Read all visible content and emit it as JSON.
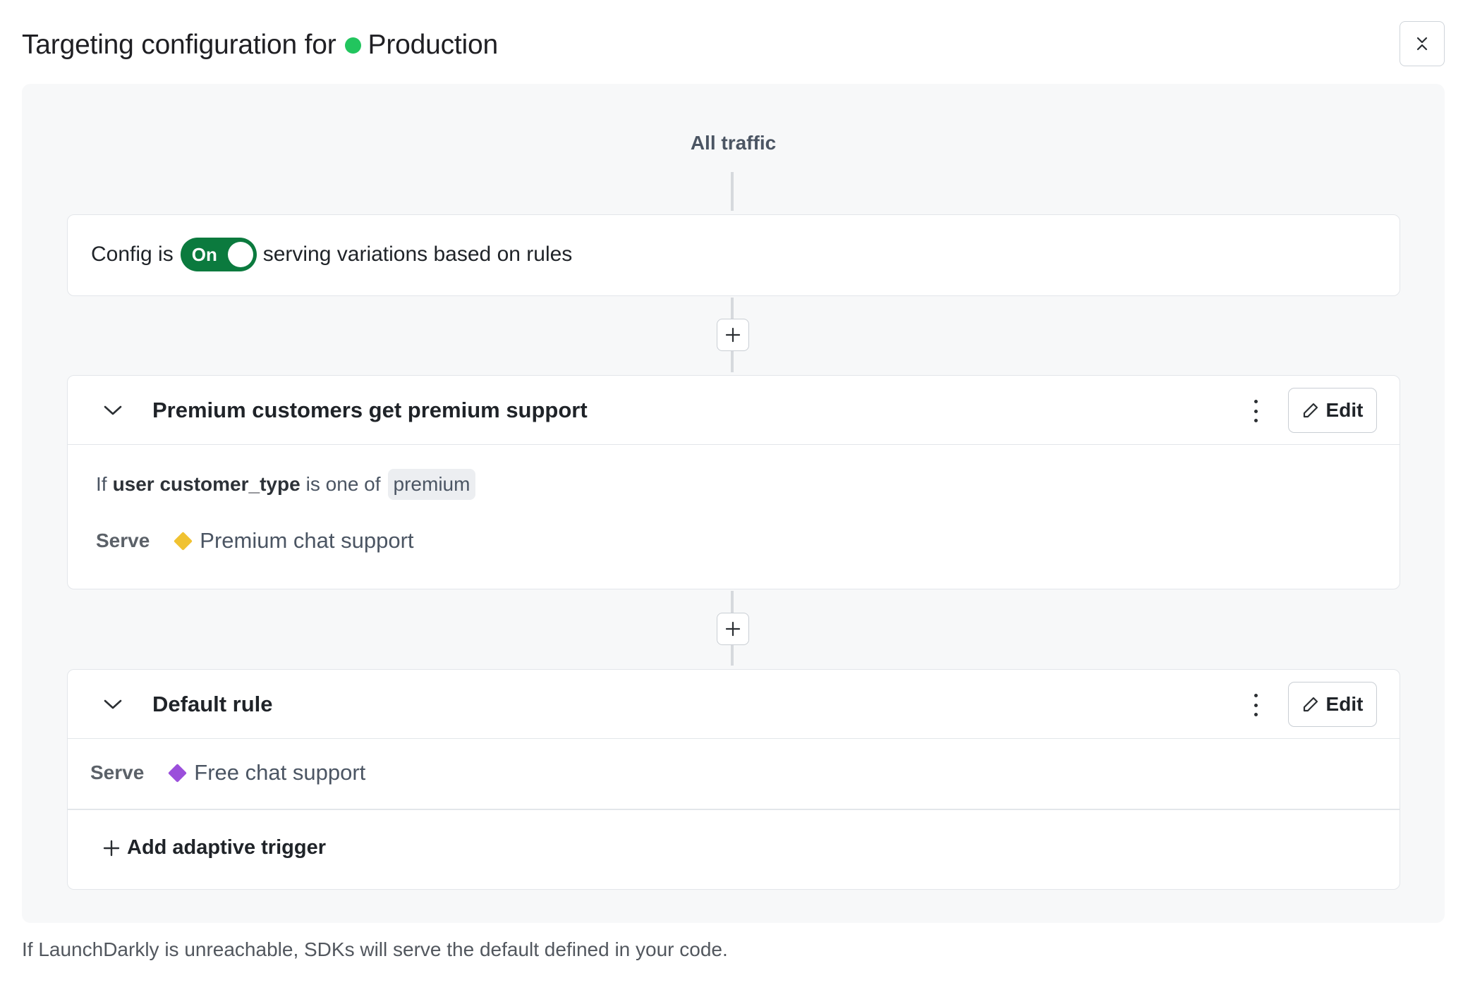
{
  "header": {
    "title_prefix": "Targeting configuration for",
    "environment": "Production",
    "environment_color": "#22c55e"
  },
  "flow": {
    "all_traffic": "All traffic",
    "config": {
      "prefix": "Config is",
      "toggle_label": "On",
      "toggle_on": true,
      "suffix": "serving variations based on rules"
    },
    "rules": [
      {
        "title": "Premium customers get premium support",
        "edit_label": "Edit",
        "clause": {
          "prefix": "If",
          "attribute": "user customer_type",
          "operator": "is one of",
          "value": "premium"
        },
        "serve_label": "Serve",
        "variation": "Premium chat support",
        "variation_color": "#f0c231"
      }
    ],
    "default_rule": {
      "title": "Default rule",
      "edit_label": "Edit",
      "serve_label": "Serve",
      "variation": "Free chat support",
      "variation_color": "#9b4fdb",
      "add_trigger_label": "Add adaptive trigger"
    }
  },
  "footer": {
    "note": "If LaunchDarkly is unreachable, SDKs will serve the default defined in your code."
  },
  "icons": [
    "collapse-icon",
    "plus-icon",
    "chevron-down-icon",
    "kebab-icon",
    "pencil-icon",
    "diamond-icon"
  ]
}
